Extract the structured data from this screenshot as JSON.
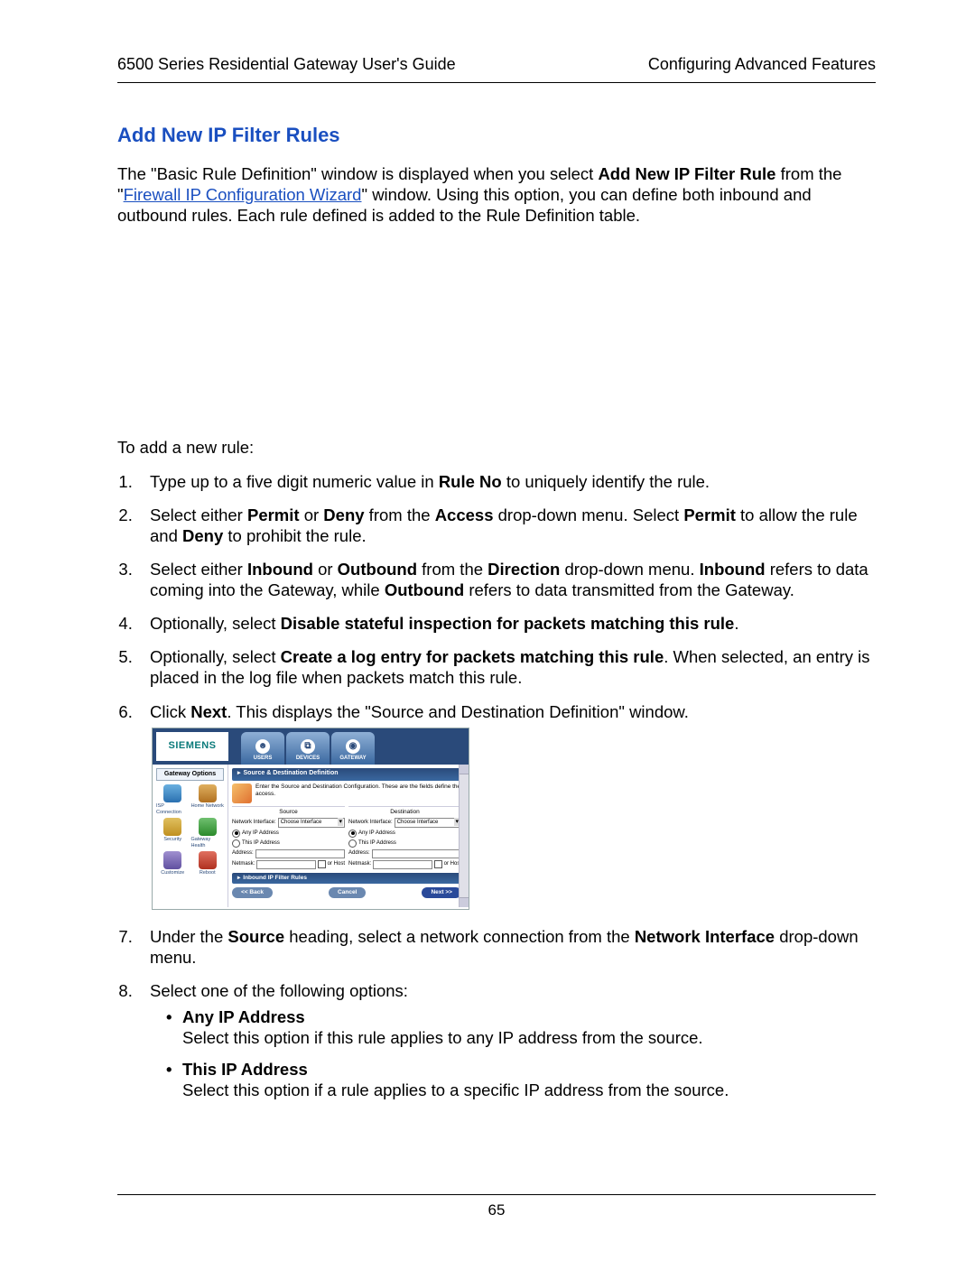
{
  "header": {
    "left": "6500 Series Residential Gateway User's Guide",
    "right": "Configuring Advanced Features"
  },
  "section_title": "Add New IP Filter Rules",
  "intro": {
    "pre": "The \"Basic Rule Definition\" window is displayed when you select ",
    "bold1": "Add New IP Filter Rule",
    "mid1": " from the \"",
    "link": "Firewall IP Configuration Wizard",
    "post": "\" window. Using this option, you can define both inbound and outbound rules. Each rule defined is added to the Rule Definition table."
  },
  "lead": "To add a new rule:",
  "steps": {
    "s1": {
      "pre": "Type up to a five digit numeric value in ",
      "b1": "Rule No",
      "post": " to uniquely identify the rule."
    },
    "s2": {
      "pre": "Select either ",
      "b1": "Permit",
      "m1": " or ",
      "b2": "Deny",
      "m2": " from the ",
      "b3": "Access",
      "m3": " drop-down menu. Select ",
      "b4": "Permit",
      "m4": " to allow the rule and ",
      "b5": "Deny",
      "post": " to prohibit the rule."
    },
    "s3": {
      "pre": "Select either ",
      "b1": "Inbound",
      "m1": " or ",
      "b2": "Outbound",
      "m2": " from the ",
      "b3": "Direction",
      "m3": " drop-down menu. ",
      "b4": "Inbound",
      "m4": " refers to data coming into the Gateway, while ",
      "b5": "Outbound",
      "post": " refers to data transmitted from the Gateway."
    },
    "s4": {
      "pre": "Optionally, select ",
      "b1": "Disable stateful inspection for packets matching this rule",
      "post": "."
    },
    "s5": {
      "pre": "Optionally, select ",
      "b1": "Create a log entry for packets matching this rule",
      "post": ". When selected, an entry is placed in the log file when packets match this rule."
    },
    "s6": {
      "pre": "Click ",
      "b1": "Next",
      "post": ". This displays the \"Source and Destination Definition\" window."
    },
    "s7": {
      "pre": "Under the ",
      "b1": "Source",
      "m1": " heading, select a network connection from the ",
      "b2": "Network Interface",
      "post": " drop-down menu."
    },
    "s8": {
      "pre": "Select one of the following options:"
    }
  },
  "bullets": {
    "b1": {
      "title": "Any IP Address",
      "desc": "Select this option if this rule applies to any IP address from the source."
    },
    "b2": {
      "title": "This IP Address",
      "desc": "Select this option if a rule applies to a specific IP address from the source."
    }
  },
  "screenshot": {
    "logo": "SIEMENS",
    "tabs": {
      "users": "USERS",
      "devices": "DEVICES",
      "gateway": "GATEWAY"
    },
    "sidebar_title": "Gateway Options",
    "sidebar": {
      "i1": "ISP Connection",
      "i2": "Home Network",
      "i3": "Security",
      "i4": "Gateway Health",
      "i5": "Customize",
      "i6": "Reboot"
    },
    "bar1": "Source & Destination Definition",
    "instr": "Enter the Source and Destination Configuration. These are the fields define the access.",
    "col_source": "Source",
    "col_dest": "Destination",
    "ni_label": "Network Interface:",
    "ni_value": "Choose Interface",
    "any_ip": "Any IP Address",
    "this_ip": "This IP Address",
    "addr": "Address:",
    "netmask": "Netmask:",
    "or_host": "or Host",
    "bar2": "Inbound IP Filter Rules",
    "btn_back": "<< Back",
    "btn_cancel": "Cancel",
    "btn_next": "Next >>"
  },
  "page_number": "65"
}
